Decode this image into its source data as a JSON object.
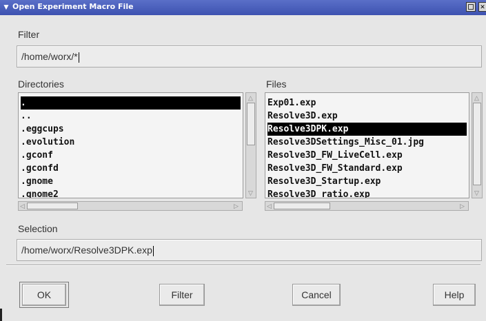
{
  "window": {
    "title": "Open Experiment Macro File"
  },
  "filter": {
    "label": "Filter",
    "value": "/home/worx/*"
  },
  "directories": {
    "label": "Directories",
    "items": [
      ".",
      "..",
      ".eggcups",
      ".evolution",
      ".gconf",
      ".gconfd",
      ".gnome",
      ".gnome2"
    ],
    "selected_index": 0
  },
  "files": {
    "label": "Files",
    "items": [
      "Exp01.exp",
      "Resolve3D.exp",
      "Resolve3DPK.exp",
      "Resolve3DSettings_Misc_01.jpg",
      "Resolve3D_FW_LiveCell.exp",
      "Resolve3D_FW_Standard.exp",
      "Resolve3D_Startup.exp",
      "Resolve3D_ratio.exp"
    ],
    "selected_index": 2
  },
  "selection": {
    "label": "Selection",
    "value": "/home/worx/Resolve3DPK.exp"
  },
  "buttons": {
    "ok": "OK",
    "filter": "Filter",
    "cancel": "Cancel",
    "help": "Help"
  },
  "colors": {
    "titlebar": "#3d52b0",
    "selected_bg": "#000000",
    "selected_fg": "#ffffff"
  }
}
